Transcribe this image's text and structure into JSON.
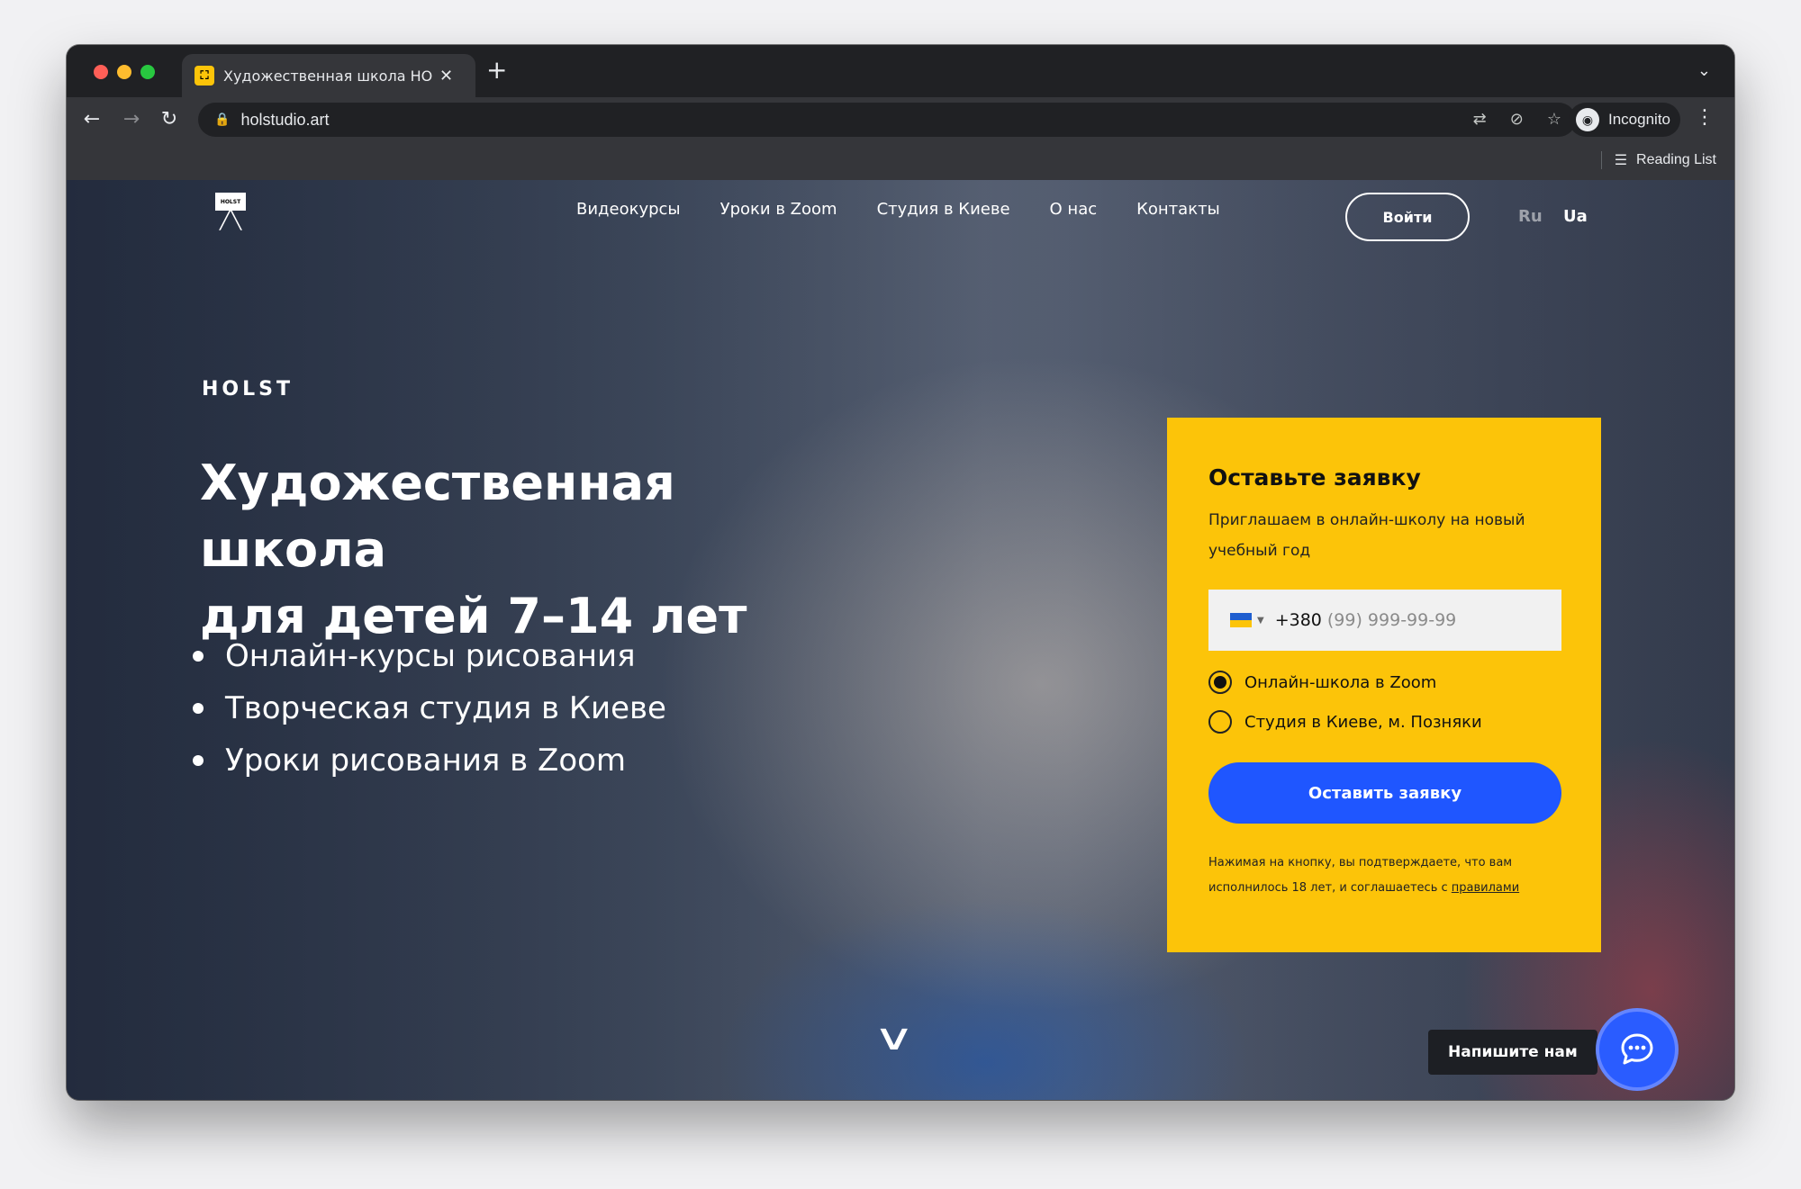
{
  "browser": {
    "tab": {
      "title": "Художественная школа HOLST",
      "favicon": "easel-icon"
    },
    "url": "holstudio.art",
    "profile": "Incognito",
    "reading_list": "Reading List"
  },
  "site": {
    "nav": [
      {
        "label": "Видеокурсы"
      },
      {
        "label": "Уроки в Zoom"
      },
      {
        "label": "Студия в Киеве"
      },
      {
        "label": "О нас"
      },
      {
        "label": "Контакты"
      }
    ],
    "login": "Войти",
    "languages": {
      "ru": "Ru",
      "ua": "Ua"
    },
    "brand": "HOLST",
    "hero_title_line1": "Художественная школа",
    "hero_title_line2": "для детей 7–14 лет",
    "features": [
      "Онлайн-курсы рисования",
      "Творческая студия в Киеве",
      "Уроки рисования в Zoom"
    ]
  },
  "form": {
    "title": "Оставьте заявку",
    "subtitle": "Приглашаем в онлайн-школу на новый учебный год",
    "phone": {
      "code": "+380",
      "placeholder": "(99) 999-99-99"
    },
    "options": [
      {
        "label": "Онлайн-школа в Zoom",
        "selected": true
      },
      {
        "label": "Студия в Киеве, м. Позняки",
        "selected": false
      }
    ],
    "submit": "Оставить заявку",
    "consent_text": "Нажимая на кнопку, вы подтверждаете, что вам исполнилось 18 лет, и соглашаетесь с",
    "consent_link": "правилами"
  },
  "chat": {
    "label": "Напишите нам"
  },
  "colors": {
    "accent_yellow": "#fcc409",
    "button_blue": "#1f56ff"
  }
}
